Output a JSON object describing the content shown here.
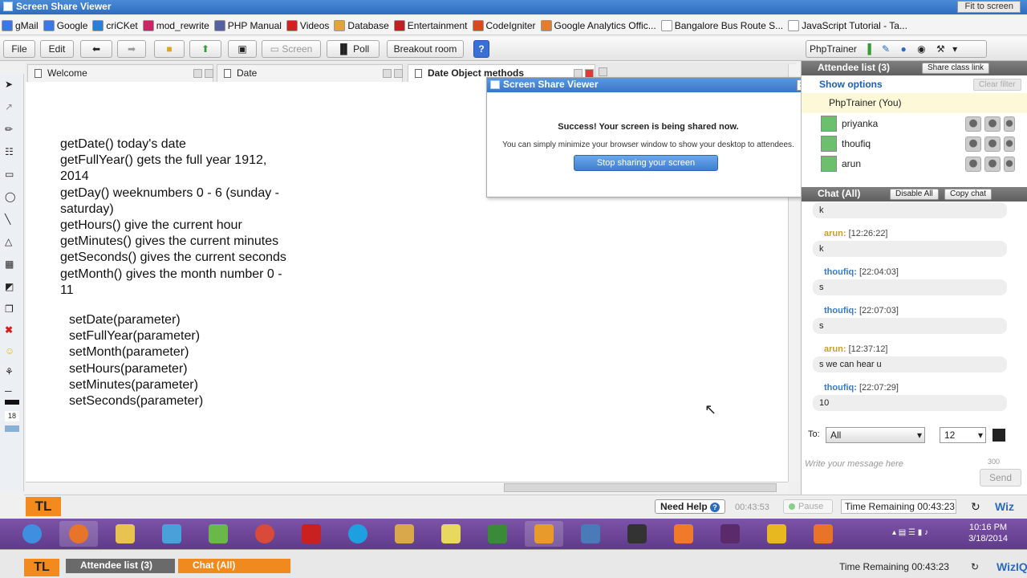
{
  "window": {
    "title": "Screen Share Viewer",
    "fit_label": "Fit to screen"
  },
  "bookmarks": [
    {
      "label": "gMail",
      "color": "#3b78e7"
    },
    {
      "label": "Google",
      "color": "#3b78e7"
    },
    {
      "label": "criCKet",
      "color": "#2a7fd8"
    },
    {
      "label": "mod_rewrite",
      "color": "#cc2266"
    },
    {
      "label": "PHP Manual",
      "color": "#5560a0"
    },
    {
      "label": "Videos",
      "color": "#d32222"
    },
    {
      "label": "Database",
      "color": "#e2a33a"
    },
    {
      "label": "Entertainment",
      "color": "#c02020"
    },
    {
      "label": "CodeIgniter",
      "color": "#d94a1a"
    },
    {
      "label": "Google Analytics Offic...",
      "color": "#e47d2b"
    },
    {
      "label": "Bangalore Bus Route S...",
      "color": "#ffffff"
    },
    {
      "label": "JavaScript Tutorial - Ta...",
      "color": "#ffffff"
    }
  ],
  "toolbar": {
    "file": "File",
    "edit": "Edit",
    "screen": "Screen",
    "poll": "Poll",
    "breakout": "Breakout room",
    "help": "?",
    "user": "PhpTrainer"
  },
  "tabs": [
    {
      "label": "Welcome"
    },
    {
      "label": "Date"
    },
    {
      "label": "Date Object methods"
    }
  ],
  "board": {
    "block1": "getDate() today's date\ngetFullYear() gets the full year 1912,\n2014\ngetDay() weeknumbers 0 - 6 (sunday -\nsaturday)\ngetHours() give the current hour\ngetMinutes() gives the current minutes\ngetSeconds() gives the current seconds\ngetMonth() gives the month number 0 -\n11",
    "block2": "setDate(parameter)\nsetFullYear(parameter)\nsetMonth(parameter)\nsetHours(parameter)\nsetMinutes(parameter)\nsetSeconds(parameter)",
    "tool_size": "18"
  },
  "popup": {
    "title": "Screen Share Viewer",
    "close": "×",
    "success": "Success! Your screen is being shared now.",
    "info": "You can simply minimize your browser window to show your desktop to attendees.",
    "stop": "Stop sharing your screen"
  },
  "attendees": {
    "title": "Attendee list (3)",
    "share_link": "Share class link",
    "show_options": "Show options",
    "clear_filter": "Clear filter",
    "me": "PhpTrainer  (You)",
    "people": [
      {
        "name": "priyanka"
      },
      {
        "name": "thoufiq"
      },
      {
        "name": "arun"
      }
    ]
  },
  "chat": {
    "title": "Chat (All)",
    "disable_all": "Disable All",
    "copy_chat": "Copy chat",
    "first_message": "k",
    "messages": [
      {
        "name": "arun:",
        "time": "[12:26:22]",
        "text": "k"
      },
      {
        "name": "thoufiq:",
        "time": "[22:04:03]",
        "text": "s"
      },
      {
        "name": "thoufiq:",
        "time": "[22:07:03]",
        "text": "s"
      },
      {
        "name": "arun:",
        "time": "[12:37:12]",
        "text": "s we can hear u"
      },
      {
        "name": "thoufiq:",
        "time": "[22:07:29]",
        "text": "10"
      }
    ],
    "to_label": "To:",
    "to_value": "All",
    "font_size": "12",
    "input_placeholder": "Write your message here",
    "char_limit": "300",
    "send": "Send"
  },
  "status": {
    "need_help": "Need Help",
    "elapsed": "00:43:53",
    "pause": "Pause",
    "time_remaining": "Time Remaining",
    "remaining": "00:43:23",
    "wiz": "Wiz",
    "logo": "TL"
  },
  "taskbar": {
    "time": "10:16 PM",
    "date": "3/18/2014",
    "apps": [
      {
        "name": "itunes-icon",
        "color": "#3f8fe0"
      },
      {
        "name": "firefox-icon",
        "color": "#e8742a"
      },
      {
        "name": "folder-icon",
        "color": "#e8c350"
      },
      {
        "name": "control-panel-icon",
        "color": "#4aa0d8"
      },
      {
        "name": "chart-app-icon",
        "color": "#6bb84a"
      },
      {
        "name": "chrome-icon",
        "color": "#d94a3a"
      },
      {
        "name": "filezilla-icon",
        "color": "#c92020"
      },
      {
        "name": "skype-icon",
        "color": "#1ea0e0"
      },
      {
        "name": "transfer-icon",
        "color": "#d8a84a"
      },
      {
        "name": "notes-icon",
        "color": "#e8d860"
      },
      {
        "name": "hs-icon",
        "color": "#3a8a3a"
      },
      {
        "name": "sublime-icon",
        "color": "#e89a2a"
      },
      {
        "name": "virtualbox-icon",
        "color": "#4a7ab8"
      },
      {
        "name": "film-icon",
        "color": "#333333"
      },
      {
        "name": "xampp-icon",
        "color": "#f07a2a"
      },
      {
        "name": "flash-builder-icon",
        "color": "#5a2a6a"
      },
      {
        "name": "word-icon",
        "color": "#e8b820"
      },
      {
        "name": "paint-icon",
        "color": "#e8742a"
      }
    ]
  },
  "bottom": {
    "logo": "TL",
    "attendee_tab": "Attendee list (3)",
    "chat_tab": "Chat (All)",
    "time_remaining": "Time Remaining",
    "remaining": "00:43:23",
    "wiz": "WizIQ"
  }
}
